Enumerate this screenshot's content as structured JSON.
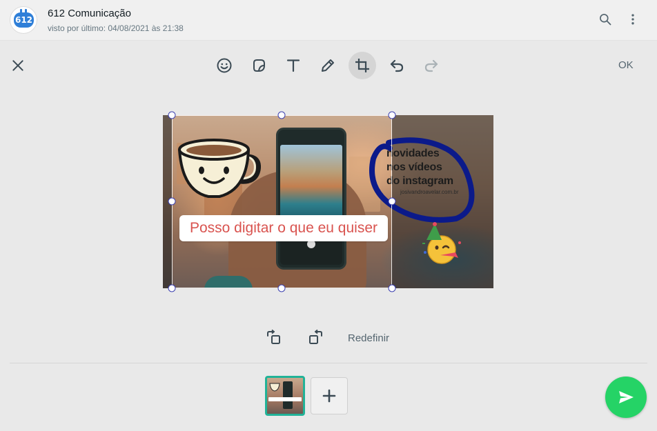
{
  "header": {
    "avatar_text": "612",
    "contact_name": "612 Comunicação",
    "last_seen": "visto por último: 04/08/2021 às 21:38",
    "icons": [
      "search-icon",
      "menu-dots-icon"
    ]
  },
  "toolbar": {
    "tools": [
      "emoji-icon",
      "sticker-icon",
      "text-icon",
      "pencil-icon",
      "crop-icon",
      "undo-icon",
      "redo-icon"
    ],
    "active_tool": "crop-icon",
    "ok_label": "OK"
  },
  "canvas": {
    "caption": "Posso digitar o que eu quiser",
    "promo_lines": [
      "novidades",
      "nos vídeos",
      "do instagram"
    ],
    "promo_url": "josivandroavelar.com.br",
    "scribble_color": "#0b1a8a",
    "caption_color": "#d9534f"
  },
  "crop": {
    "reset_label": "Redefinir",
    "icons": [
      "rotate-left-icon",
      "rotate-right-icon"
    ]
  },
  "footer": {
    "thumbnails": 1,
    "add_icon": "plus-icon",
    "send_icon": "send-icon",
    "send_color": "#25d366",
    "accent_color": "#21b398"
  }
}
